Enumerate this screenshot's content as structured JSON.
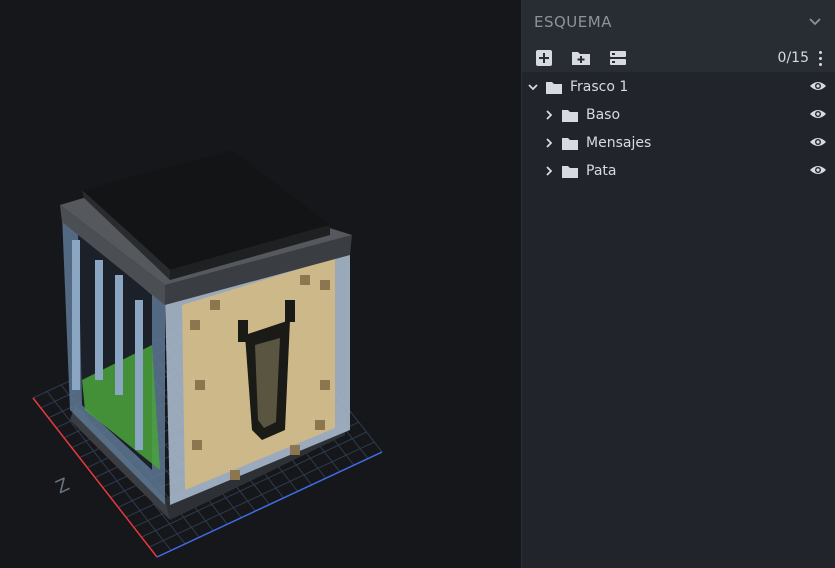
{
  "panel": {
    "title": "ESQUEMA",
    "counter": "0/15",
    "tools": [
      {
        "name": "add-cube-icon"
      },
      {
        "name": "add-group-icon"
      },
      {
        "name": "add-locator-icon"
      }
    ]
  },
  "outline": {
    "root": {
      "label": "Frasco 1",
      "expanded": true
    },
    "children": [
      {
        "label": "Baso",
        "expanded": false
      },
      {
        "label": "Mensajes",
        "expanded": false
      },
      {
        "label": "Pata",
        "expanded": false
      }
    ]
  },
  "viewport": {
    "axis_label": "Z"
  },
  "colors": {
    "panel_bg": "#21252b",
    "viewport_bg": "#16171b",
    "text": "#d7dae0",
    "muted": "#8d939c",
    "grid": "#2e3b4e",
    "axis_x": "#e5393c",
    "axis_z": "#3f6de5"
  }
}
